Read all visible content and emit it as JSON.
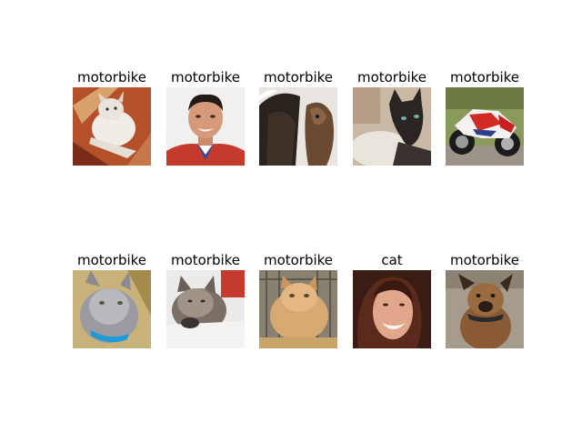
{
  "grid": {
    "rows": [
      [
        {
          "label": "motorbike",
          "subject": "white cat lying on red patterned blanket"
        },
        {
          "label": "motorbike",
          "subject": "smiling man wearing a medal ribbon"
        },
        {
          "label": "motorbike",
          "subject": "dark horse head close-up"
        },
        {
          "label": "motorbike",
          "subject": "dark siamese cat on light background"
        },
        {
          "label": "motorbike",
          "subject": "red and white sport motorcycle"
        }
      ],
      [
        {
          "label": "motorbike",
          "subject": "grey cat with blue collar"
        },
        {
          "label": "motorbike",
          "subject": "tabby cat lying on white blanket"
        },
        {
          "label": "motorbike",
          "subject": "orange tabby cat in a cage"
        },
        {
          "label": "cat",
          "subject": "laughing woman with dark hair"
        },
        {
          "label": "motorbike",
          "subject": "brown dog wearing collar"
        }
      ]
    ]
  }
}
